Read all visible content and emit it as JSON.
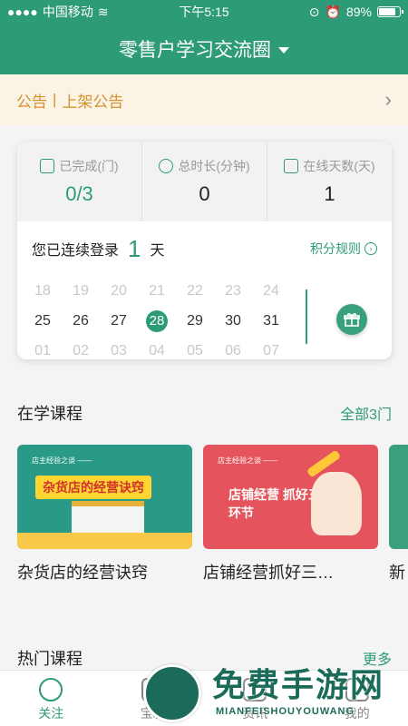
{
  "status_bar": {
    "carrier": "中国移动",
    "time": "下午5:15",
    "battery": "89%"
  },
  "header": {
    "title": "零售户学习交流圈"
  },
  "notice": {
    "label": "公告",
    "separator": "|",
    "text": "上架公告"
  },
  "stats": [
    {
      "label": "已完成(门)",
      "value": "0/3",
      "icon": "check-clipboard-icon"
    },
    {
      "label": "总时长(分钟)",
      "value": "0",
      "icon": "clock-icon"
    },
    {
      "label": "在线天数(天)",
      "value": "1",
      "icon": "monitor-check-icon"
    }
  ],
  "signin": {
    "prefix": "您已连续登录",
    "days": "1",
    "suffix": "天",
    "rules_label": "积分规则",
    "calendar": [
      [
        {
          "d": "18",
          "s": "dim"
        },
        {
          "d": "19",
          "s": "dim"
        },
        {
          "d": "20",
          "s": "dim"
        },
        {
          "d": "21",
          "s": "dim"
        },
        {
          "d": "22",
          "s": "dim"
        },
        {
          "d": "23",
          "s": "dim"
        },
        {
          "d": "24",
          "s": "dim"
        }
      ],
      [
        {
          "d": "25",
          "s": "cur"
        },
        {
          "d": "26",
          "s": "cur"
        },
        {
          "d": "27",
          "s": "cur"
        },
        {
          "d": "28",
          "s": "today"
        },
        {
          "d": "29",
          "s": "cur"
        },
        {
          "d": "30",
          "s": "cur"
        },
        {
          "d": "31",
          "s": "cur"
        }
      ],
      [
        {
          "d": "01",
          "s": "dim"
        },
        {
          "d": "02",
          "s": "dim"
        },
        {
          "d": "03",
          "s": "dim"
        },
        {
          "d": "04",
          "s": "dim"
        },
        {
          "d": "05",
          "s": "dim"
        },
        {
          "d": "06",
          "s": "dim"
        },
        {
          "d": "07",
          "s": "dim"
        }
      ]
    ]
  },
  "learning": {
    "heading": "在学课程",
    "more": "全部3门",
    "courses": [
      {
        "title": "杂货店的经营诀窍",
        "banner": "杂货店的经营诀窍"
      },
      {
        "title": "店铺经营抓好三…",
        "banner": "店铺经营 抓好三个关键环节"
      },
      {
        "title": "新"
      }
    ]
  },
  "hot": {
    "heading": "热门课程",
    "more": "更多"
  },
  "tabs": [
    {
      "label": "关注",
      "icon": "compass-icon",
      "active": true
    },
    {
      "label": "宝箱",
      "icon": "treasure-box-icon"
    },
    {
      "label": "资讯",
      "icon": "news-icon"
    },
    {
      "label": "我的",
      "icon": "profile-icon"
    }
  ],
  "watermark": {
    "title": "免费手游网",
    "subtitle": "MIANFEISHOUYOUWANG"
  },
  "colors": {
    "brand": "#2e9b78",
    "notice_text": "#d7922c",
    "notice_bg": "#fbf3e6"
  }
}
